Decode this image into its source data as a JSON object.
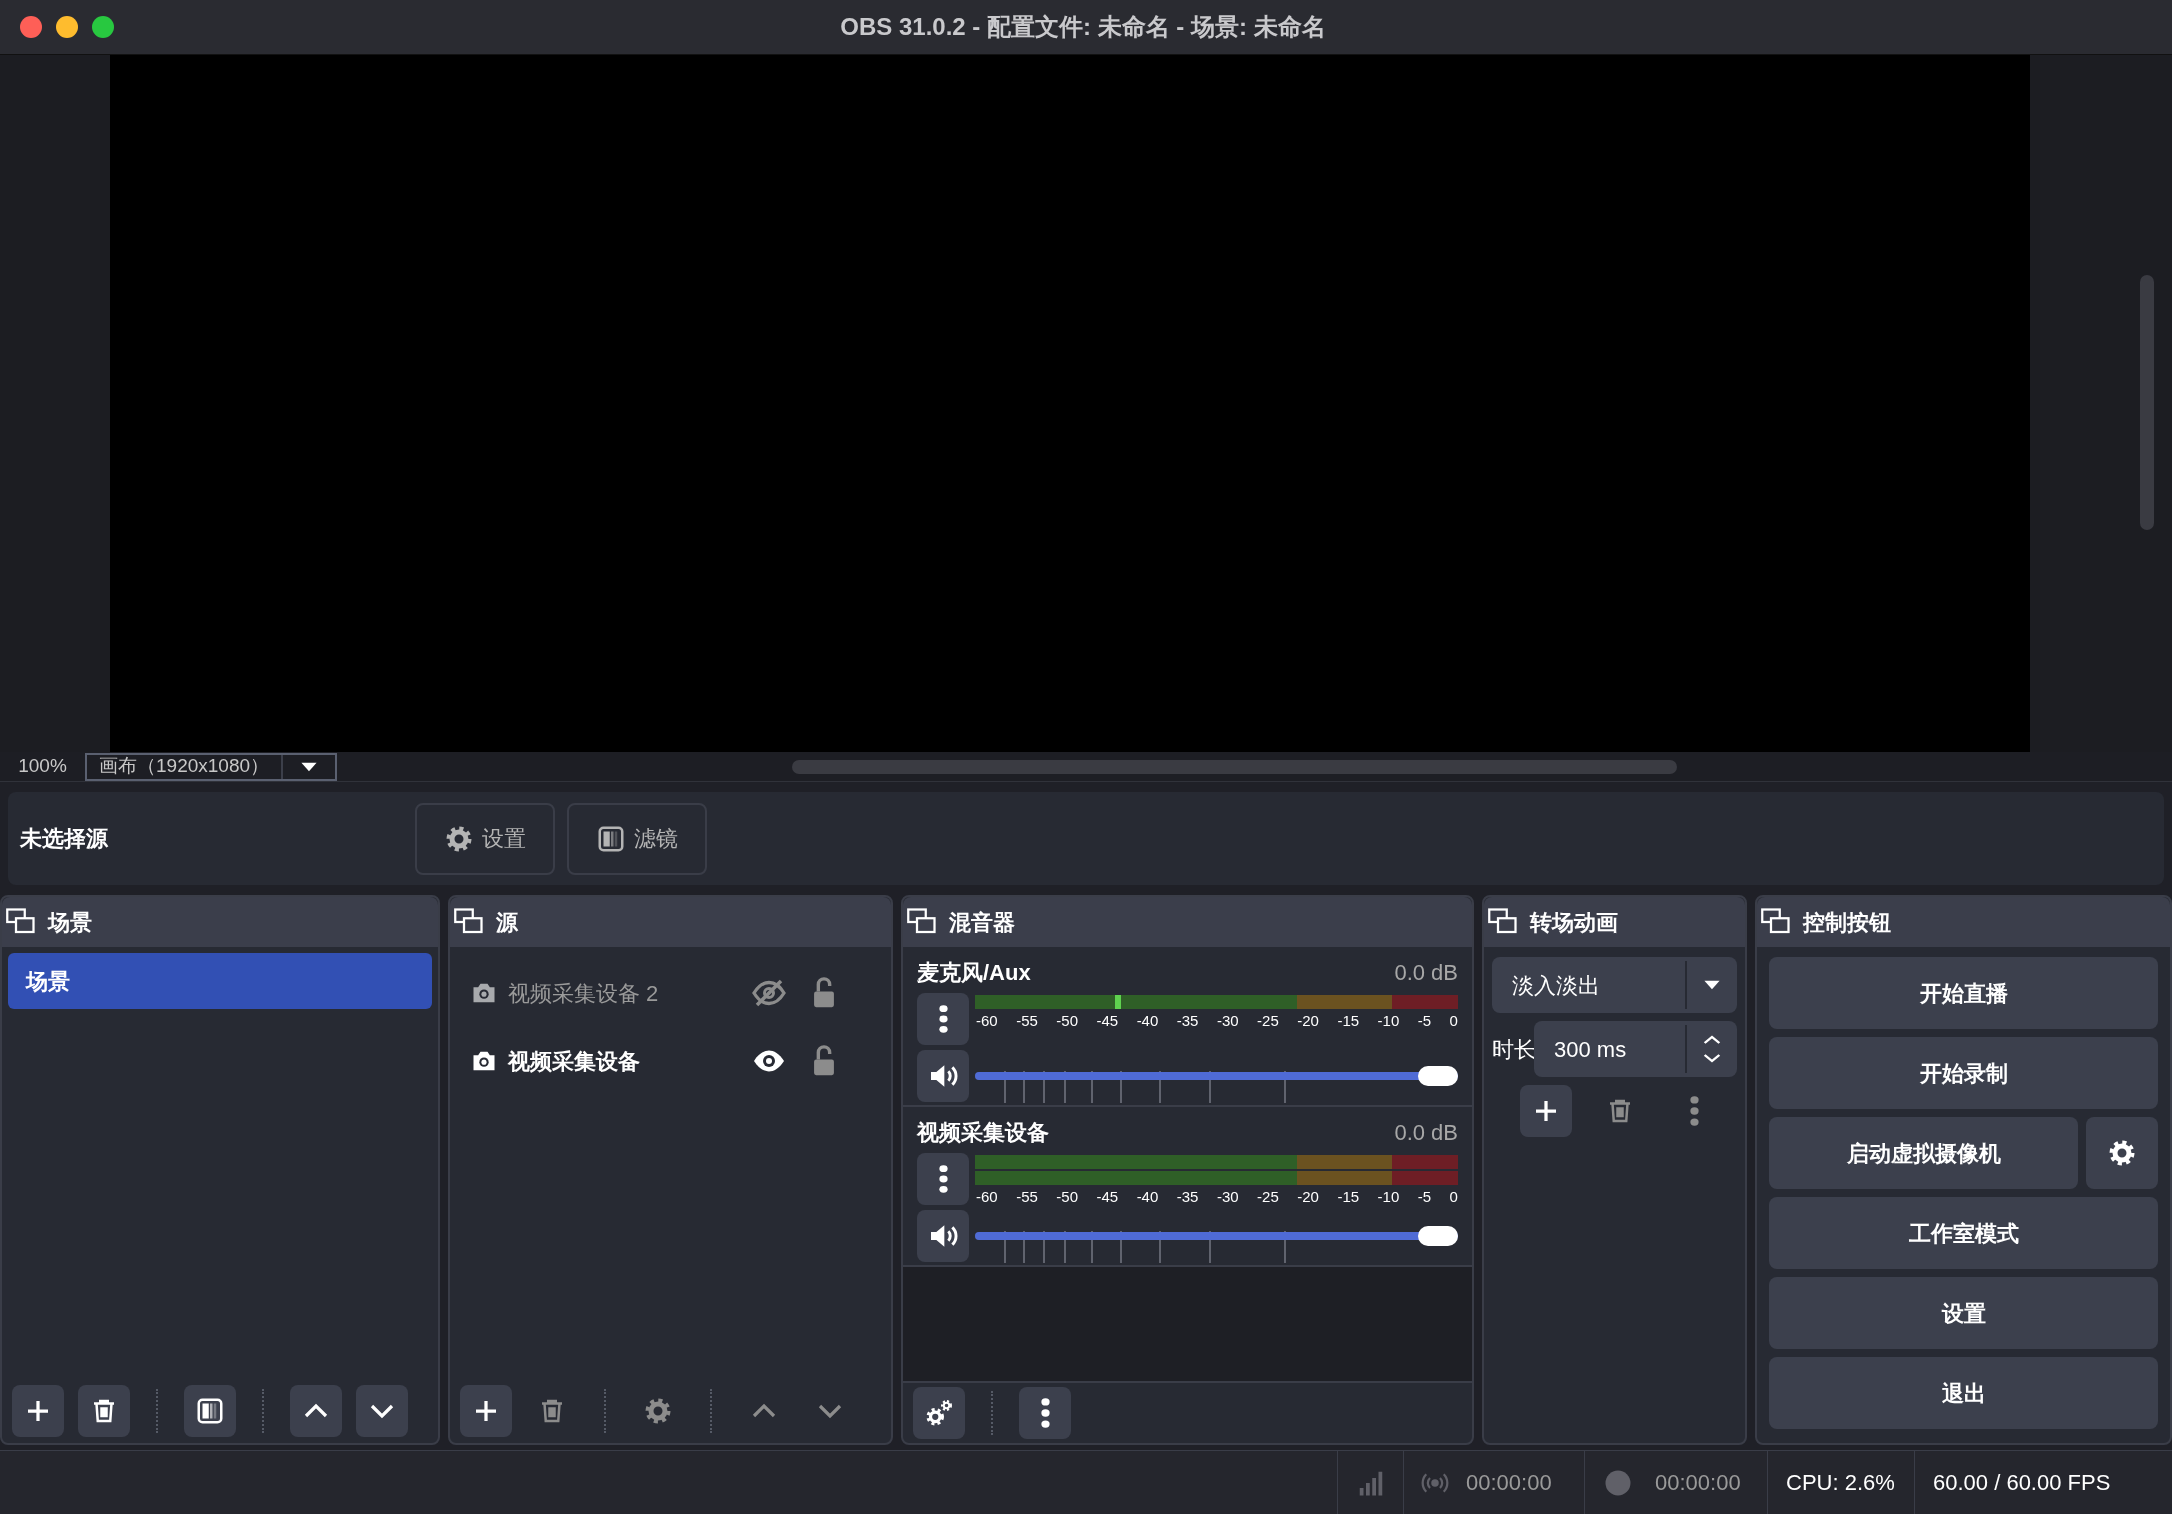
{
  "window": {
    "title": "OBS 31.0.2 - 配置文件: 未命名 - 场景: 未命名"
  },
  "preview": {
    "zoom": "100%",
    "canvas_select": "画布（1920x1080）"
  },
  "context_bar": {
    "label": "未选择源",
    "buttons": [
      {
        "kind": "properties",
        "label": "设置",
        "disabled": true
      },
      {
        "kind": "filters",
        "label": "滤镜",
        "disabled": true
      }
    ]
  },
  "scenes": {
    "title": "场景",
    "items": [
      {
        "label": "场景",
        "selected": true
      }
    ],
    "toolbar": [
      {
        "kind": "add",
        "disabled": false
      },
      {
        "kind": "remove",
        "disabled": false
      },
      {
        "kind": "filters",
        "disabled": false
      },
      {
        "kind": "up",
        "disabled": false
      },
      {
        "kind": "down",
        "disabled": false
      }
    ]
  },
  "sources": {
    "title": "源",
    "items": [
      {
        "label": "视频采集设备 2",
        "visible": false,
        "locked": false
      },
      {
        "label": "视频采集设备",
        "visible": true,
        "locked": false
      }
    ],
    "toolbar": [
      {
        "kind": "add",
        "disabled": false
      },
      {
        "kind": "remove",
        "disabled": true
      },
      {
        "kind": "properties",
        "disabled": true
      },
      {
        "kind": "up",
        "disabled": true
      },
      {
        "kind": "down",
        "disabled": true
      }
    ]
  },
  "mixer": {
    "title": "混音器",
    "channels": [
      {
        "name": "麦克风/Aux",
        "reading": "0.0 dB",
        "meter": {
          "kind": "mono",
          "level": 0.29
        },
        "scale": [
          "-60",
          "-55",
          "-50",
          "-45",
          "-40",
          "-35",
          "-30",
          "-25",
          "-20",
          "-15",
          "-10",
          "-5",
          "0"
        ],
        "level": 1
      },
      {
        "name": "视频采集设备",
        "reading": "0.0 dB",
        "meter": {
          "kind": "stereo"
        },
        "scale": [
          "-60",
          "-55",
          "-50",
          "-45",
          "-40",
          "-35",
          "-30",
          "-25",
          "-20",
          "-15",
          "-10",
          "-5",
          "0"
        ],
        "level": 1
      }
    ],
    "toolbar": [
      {
        "kind": "advanced",
        "disabled": false
      },
      {
        "kind": "menu",
        "disabled": false
      }
    ]
  },
  "transitions": {
    "title": "转场动画",
    "transition": "淡入淡出",
    "duration_label": "时长",
    "duration": "300 ms",
    "toolbar": [
      {
        "kind": "add",
        "disabled": false
      },
      {
        "kind": "remove",
        "disabled": true
      },
      {
        "kind": "menu",
        "disabled": true
      }
    ]
  },
  "controls": {
    "title": "控制按钮",
    "buttons": [
      {
        "kind": "plain",
        "label": "开始直播"
      },
      {
        "kind": "plain",
        "label": "开始录制"
      },
      {
        "kind": "with_settings",
        "label": "启动虚拟摄像机"
      },
      {
        "kind": "plain",
        "label": "工作室模式"
      },
      {
        "kind": "plain",
        "label": "设置"
      },
      {
        "kind": "plain",
        "label": "退出"
      }
    ]
  },
  "status_bar": {
    "stream_time": "00:00:00",
    "record_time": "00:00:00",
    "cpu": "CPU: 2.6%",
    "fps": "60.00 / 60.00 FPS"
  }
}
